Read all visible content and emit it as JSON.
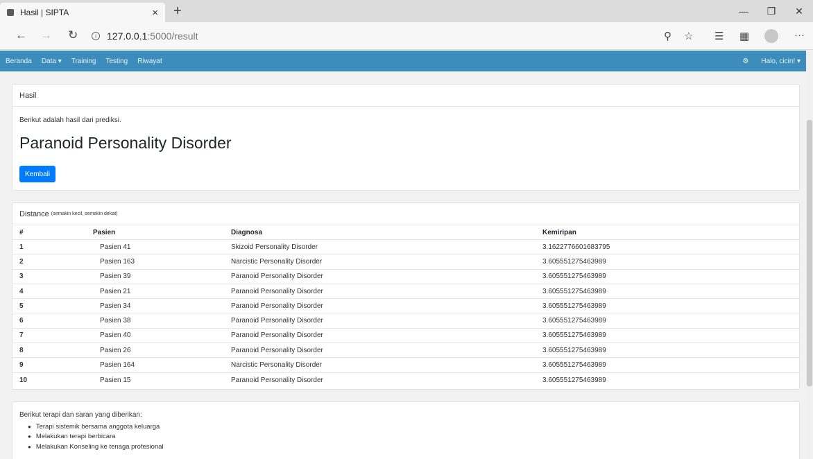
{
  "browser": {
    "tab_title": "Hasil | SIPTA",
    "tab_close": "×",
    "new_tab": "+",
    "url_host": "127.0.0.1",
    "url_path": ":5000/result",
    "info": "i",
    "more": "···"
  },
  "navbar": {
    "items": [
      "Beranda",
      "Data ▾",
      "Training",
      "Testing",
      "Riwayat"
    ],
    "user": "Halo, cicin! ▾"
  },
  "result_card": {
    "header": "Hasil",
    "intro": "Berikut adalah hasil dari prediksi.",
    "prediction": "Paranoid Personality Disorder",
    "back_button": "Kembali"
  },
  "distance_card": {
    "header": "Distance",
    "note": "(semakin kecil, semakin dekat)",
    "columns": [
      "#",
      "Pasien",
      "Diagnosa",
      "Kemiripan"
    ],
    "rows": [
      [
        "1",
        "Pasien 41",
        "Skizoid Personality Disorder",
        "3.1622776601683795"
      ],
      [
        "2",
        "Pasien 163",
        "Narcistic Personality Disorder",
        "3.605551275463989"
      ],
      [
        "3",
        "Pasien 39",
        "Paranoid Personality Disorder",
        "3.605551275463989"
      ],
      [
        "4",
        "Pasien 21",
        "Paranoid Personality Disorder",
        "3.605551275463989"
      ],
      [
        "5",
        "Pasien 34",
        "Paranoid Personality Disorder",
        "3.605551275463989"
      ],
      [
        "6",
        "Pasien 38",
        "Paranoid Personality Disorder",
        "3.605551275463989"
      ],
      [
        "7",
        "Pasien 40",
        "Paranoid Personality Disorder",
        "3.605551275463989"
      ],
      [
        "8",
        "Pasien 26",
        "Paranoid Personality Disorder",
        "3.605551275463989"
      ],
      [
        "9",
        "Pasien 164",
        "Narcistic Personality Disorder",
        "3.605551275463989"
      ],
      [
        "10",
        "Pasien 15",
        "Paranoid Personality Disorder",
        "3.605551275463989"
      ]
    ]
  },
  "therapy_card": {
    "intro": "Berikut terapi dan saran yang diberikan:",
    "items": [
      "Terapi sistemik bersama anggota keluarga",
      "Melakukan terapi berbicara",
      "Melakukan Konseling ke tenaga profesional"
    ]
  },
  "colors": {
    "navbar": "#3c8dbc",
    "primary_button": "#007bff"
  }
}
